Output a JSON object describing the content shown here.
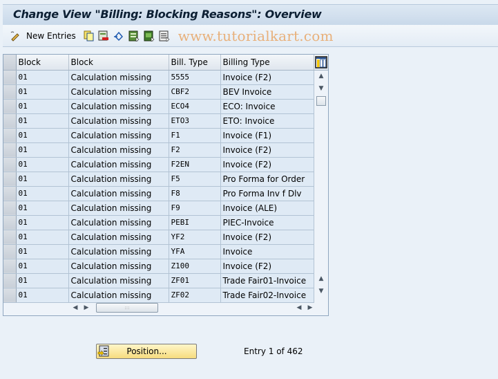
{
  "title": "Change View \"Billing: Blocking Reasons\": Overview",
  "toolbar": {
    "new_entries_label": "New Entries",
    "watermark": "www.tutorialkart.com",
    "icons": [
      "edit-pencil-icon",
      "copy-icon",
      "delete-icon",
      "undo-icon",
      "select-all-icon",
      "select-block-icon",
      "deselect-all-icon"
    ]
  },
  "table": {
    "headers": [
      "Block",
      "Block",
      "Bill. Type",
      "Billing Type"
    ],
    "rows": [
      [
        "01",
        "Calculation missing",
        "5555",
        "Invoice (F2)"
      ],
      [
        "01",
        "Calculation missing",
        "CBF2",
        "BEV Invoice"
      ],
      [
        "01",
        "Calculation missing",
        "ECO4",
        "ECO: Invoice"
      ],
      [
        "01",
        "Calculation missing",
        "ETO3",
        "ETO: Invoice"
      ],
      [
        "01",
        "Calculation missing",
        "F1",
        "Invoice (F1)"
      ],
      [
        "01",
        "Calculation missing",
        "F2",
        "Invoice (F2)"
      ],
      [
        "01",
        "Calculation missing",
        "F2EN",
        "Invoice (F2)"
      ],
      [
        "01",
        "Calculation missing",
        "F5",
        "Pro Forma for Order"
      ],
      [
        "01",
        "Calculation missing",
        "F8",
        "Pro Forma Inv f Dlv"
      ],
      [
        "01",
        "Calculation missing",
        "F9",
        "Invoice (ALE)"
      ],
      [
        "01",
        "Calculation missing",
        "PEBI",
        "PIEC-Invoice"
      ],
      [
        "01",
        "Calculation missing",
        "YF2",
        "Invoice (F2)"
      ],
      [
        "01",
        "Calculation missing",
        "YFA",
        "Invoice"
      ],
      [
        "01",
        "Calculation missing",
        "Z100",
        "Invoice (F2)"
      ],
      [
        "01",
        "Calculation missing",
        "ZF01",
        "Trade Fair01-Invoice"
      ],
      [
        "01",
        "Calculation missing",
        "ZF02",
        "Trade Fair02-Invoice"
      ]
    ]
  },
  "footer": {
    "position_label": "Position...",
    "entry_text": "Entry 1 of 462"
  }
}
